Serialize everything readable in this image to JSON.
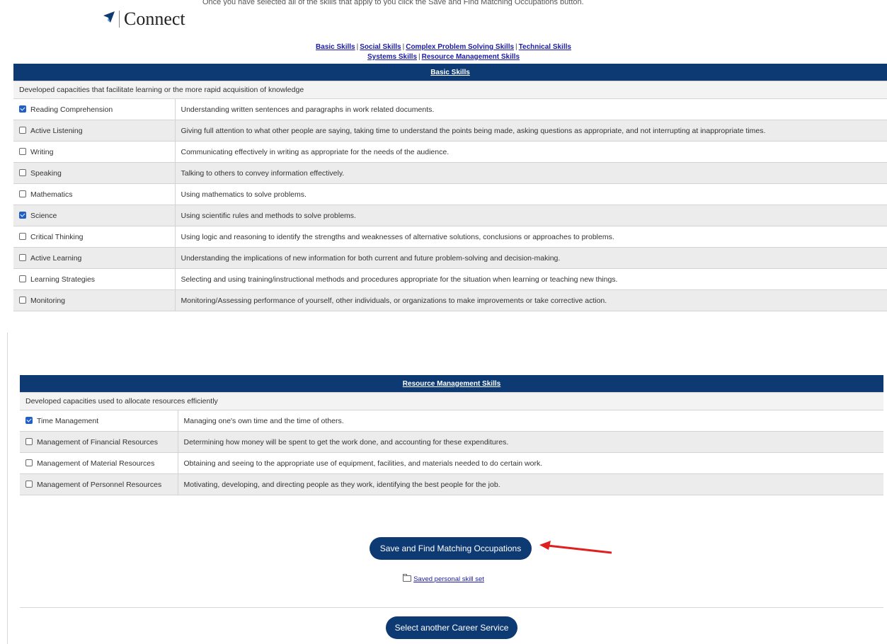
{
  "header": {
    "brand": "Connect",
    "intro_text": "Once you have selected all of the skills that apply to you click the Save and Find Matching Occupations button."
  },
  "nav_links": {
    "row1": [
      "Basic Skills",
      "Social Skills",
      "Complex Problem Solving Skills",
      "Technical Skills"
    ],
    "row2": [
      "Systems Skills",
      "Resource Management Skills"
    ],
    "separator": "|"
  },
  "basic": {
    "title": "Basic Skills",
    "description": "Developed capacities that facilitate learning or the more rapid acquisition of knowledge",
    "rows": [
      {
        "name": "Reading Comprehension",
        "desc": "Understanding written sentences and paragraphs in work related documents.",
        "checked": true
      },
      {
        "name": "Active Listening",
        "desc": "Giving full attention to what other people are saying, taking time to understand the points being made, asking questions as appropriate, and not interrupting at inappropriate times.",
        "checked": false
      },
      {
        "name": "Writing",
        "desc": "Communicating effectively in writing as appropriate for the needs of the audience.",
        "checked": false
      },
      {
        "name": "Speaking",
        "desc": "Talking to others to convey information effectively.",
        "checked": false
      },
      {
        "name": "Mathematics",
        "desc": "Using mathematics to solve problems.",
        "checked": false
      },
      {
        "name": "Science",
        "desc": "Using scientific rules and methods to solve problems.",
        "checked": true
      },
      {
        "name": "Critical Thinking",
        "desc": "Using logic and reasoning to identify the strengths and weaknesses of alternative solutions, conclusions or approaches to problems.",
        "checked": false
      },
      {
        "name": "Active Learning",
        "desc": "Understanding the implications of new information for both current and future problem-solving and decision-making.",
        "checked": false
      },
      {
        "name": "Learning Strategies",
        "desc": "Selecting and using training/instructional methods and procedures appropriate for the situation when learning or teaching new things.",
        "checked": false
      },
      {
        "name": "Monitoring",
        "desc": "Monitoring/Assessing performance of yourself, other individuals, or organizations to make improvements or take corrective action.",
        "checked": false
      }
    ]
  },
  "resource": {
    "title": "Resource Management Skills",
    "description": "Developed capacities used to allocate resources efficiently",
    "rows": [
      {
        "name": "Time Management",
        "desc": "Managing one's own time and the time of others.",
        "checked": true
      },
      {
        "name": "Management of Financial Resources",
        "desc": "Determining how money will be spent to get the work done, and accounting for these expenditures.",
        "checked": false
      },
      {
        "name": "Management of Material Resources",
        "desc": "Obtaining and seeing to the appropriate use of equipment, facilities, and materials needed to do certain work.",
        "checked": false
      },
      {
        "name": "Management of Personnel Resources",
        "desc": "Motivating, developing, and directing people as they work, identifying the best people for the job.",
        "checked": false
      }
    ]
  },
  "actions": {
    "save_label": "Save and Find Matching Occupations",
    "saved_link": "Saved personal skill set",
    "another_label": "Select another Career Service"
  },
  "colors": {
    "header_blue": "#0e3a73",
    "link_blue": "#1a1aa8",
    "checkbox_blue": "#1f5fc9",
    "annotation_red": "#e02020"
  }
}
